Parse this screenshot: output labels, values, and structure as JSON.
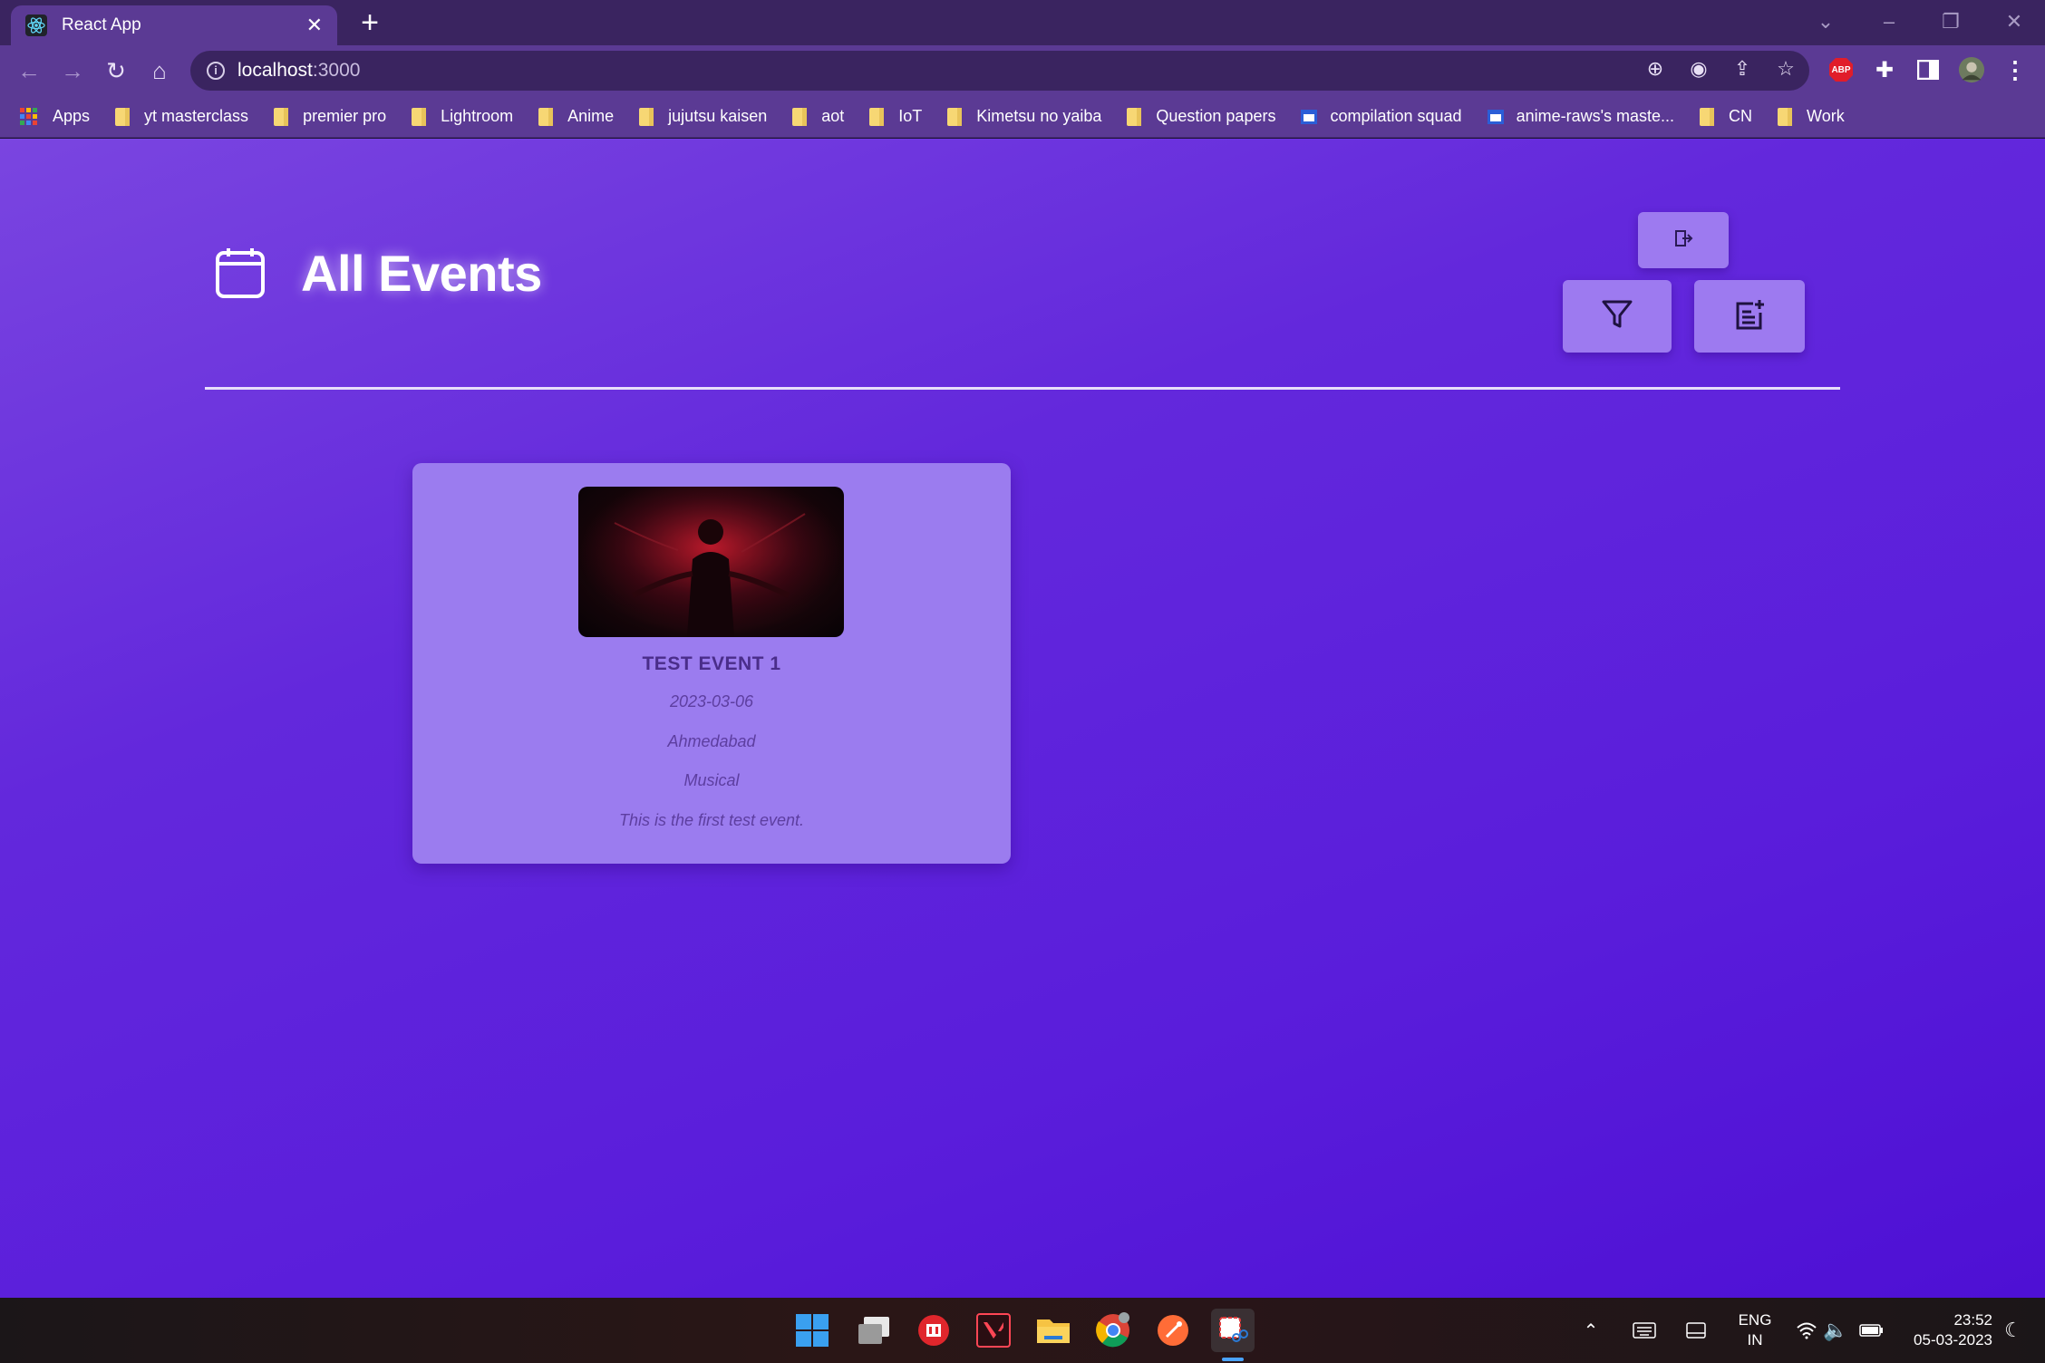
{
  "browser": {
    "tab_title": "React App",
    "new_tab_label": "+",
    "url_host": "localhost",
    "url_port": ":3000",
    "bookmarks": [
      {
        "label": "Apps",
        "type": "apps"
      },
      {
        "label": "yt masterclass",
        "type": "folder"
      },
      {
        "label": "premier pro",
        "type": "folder"
      },
      {
        "label": "Lightroom",
        "type": "folder"
      },
      {
        "label": "Anime",
        "type": "folder"
      },
      {
        "label": "jujutsu kaisen",
        "type": "folder"
      },
      {
        "label": "aot",
        "type": "folder"
      },
      {
        "label": "IoT",
        "type": "folder"
      },
      {
        "label": "Kimetsu no yaiba",
        "type": "folder"
      },
      {
        "label": "Question papers",
        "type": "folder"
      },
      {
        "label": "compilation squad",
        "type": "site"
      },
      {
        "label": "anime-raws's maste...",
        "type": "site"
      },
      {
        "label": "CN",
        "type": "folder"
      },
      {
        "label": "Work",
        "type": "folder"
      }
    ],
    "extension_badge": "ABP"
  },
  "page": {
    "title": "All Events",
    "actions": {
      "logout_icon": "logout-icon",
      "filter_icon": "filter-icon",
      "add_event_icon": "add-note-icon"
    },
    "events": [
      {
        "name": "TEST EVENT 1",
        "date": "2023-03-06",
        "city": "Ahmedabad",
        "category": "Musical",
        "description": "This is the first test event."
      }
    ]
  },
  "taskbar": {
    "language": "ENG",
    "region": "IN",
    "time": "23:52",
    "date": "05-03-2023"
  },
  "colors": {
    "page_gradient_start": "#7a45e0",
    "page_gradient_end": "#4e10d4",
    "card_bg": "#9b7cef",
    "button_bg": "#9d7af0",
    "browser_frame": "#5b3a94"
  }
}
